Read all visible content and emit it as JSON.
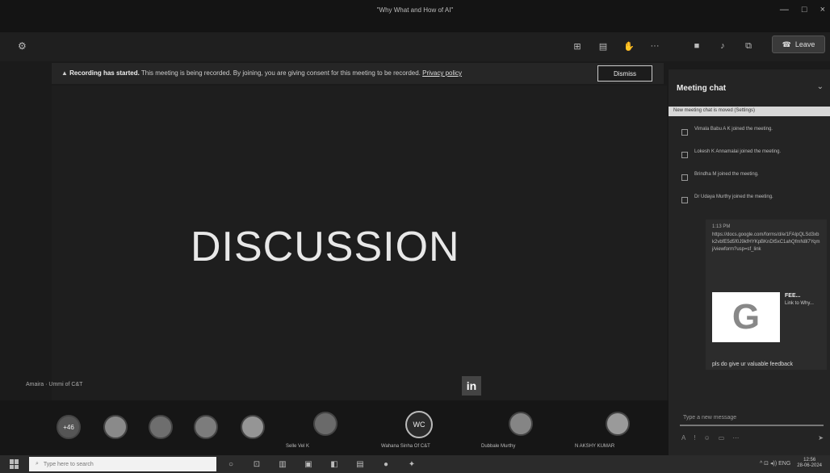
{
  "window": {
    "title": "\"Why What and How of AI\"",
    "minimize": "—",
    "maximize": "□",
    "close": "×"
  },
  "toolbar": {
    "settings_glyph": "⚙",
    "icons": [
      {
        "name": "participants-icon",
        "glyph": "⊞"
      },
      {
        "name": "chat-icon",
        "glyph": "▤"
      },
      {
        "name": "raise-hand-icon",
        "glyph": "✋"
      },
      {
        "name": "more-options-icon",
        "glyph": "···"
      },
      {
        "name": "camera-icon",
        "glyph": "■"
      },
      {
        "name": "mic-icon",
        "glyph": "♪"
      },
      {
        "name": "share-screen-icon",
        "glyph": "⧉"
      }
    ],
    "leave_icon": "☎",
    "leave_label": "Leave"
  },
  "banner": {
    "warning_glyph": "▲",
    "bold": "Recording has started.",
    "text": " This meeting is being recorded. By joining, you are giving consent for this meeting to be recorded.",
    "link": "Privacy policy",
    "dismiss_label": "Dismiss"
  },
  "stage": {
    "slide_text": "DISCUSSION",
    "presenter": "Amaira · Ummi of C&T",
    "logo_text": "in"
  },
  "participants": {
    "count_badge": "+46",
    "initials": "WC",
    "labels": [
      "Selle Vel K",
      "Wahana Sinha Of C&T",
      "Dubbale Murthy",
      "N AKSHY KUMAR"
    ]
  },
  "chat": {
    "title": "Meeting chat",
    "close_glyph": "⌄",
    "tooltip": "New meeting chat is moved (Settings)",
    "events": [
      "Vimala Babu A K joined the meeting.",
      "Lokesh K Annamalai joined the meeting.",
      "Brindha M joined the meeting.",
      "Dr Udaya Murthy joined the meeting."
    ],
    "message": {
      "timestamp": "1:13 PM",
      "link": "https://docs.google.com/forms/d/e/1FAIpQLSd3xbk2vbfE5d5f0J9kfHYKpBKnDt5xC1ahQfmN8l7Yqmj/viewform?usp=sf_link",
      "preview_title": "FEE...",
      "preview_text": "Link to Why...",
      "preview_logo": "G"
    },
    "feedback_text": "pls do give ur valuable feedback",
    "compose_placeholder": "Type a new message",
    "compose_tools": [
      "A",
      "!",
      "☺",
      "▭",
      "⋯"
    ],
    "send_glyph": "➤"
  },
  "taskbar": {
    "search_placeholder": "Type here to search",
    "search_glyph": "⌕",
    "task_icons": [
      "○",
      "⊡",
      "▥",
      "▣",
      "◧",
      "▤",
      "●",
      "✦"
    ],
    "tray_text": "^ ⊡ ◂)) ENG",
    "time": "12:56",
    "date": "28-06-2024"
  }
}
